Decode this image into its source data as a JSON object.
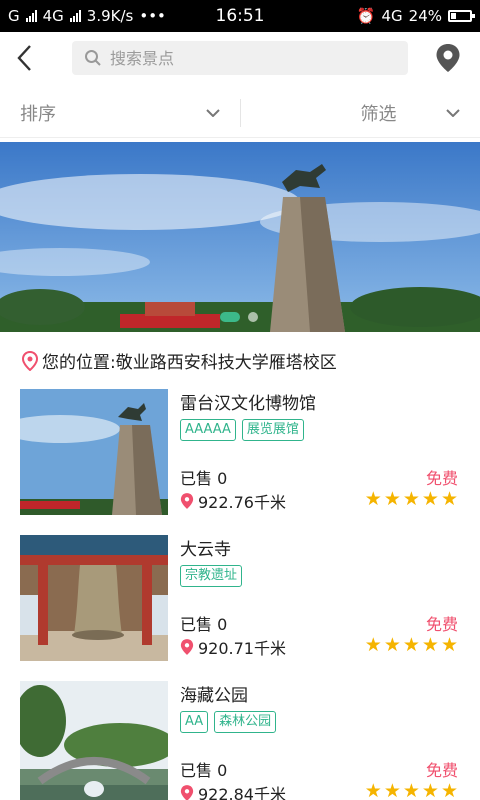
{
  "status": {
    "carrier": "G",
    "network": "4G",
    "speed": "3.9K/s",
    "dots": "•••",
    "time": "16:51",
    "net_right": "4G",
    "battery": "24%"
  },
  "search": {
    "placeholder": "搜索景点"
  },
  "filters": [
    {
      "label": "排序"
    },
    {
      "label": "筛选"
    }
  ],
  "banner": {
    "slides": 2,
    "active_index": 0
  },
  "location": {
    "text": "您的位置:敬业路西安科技大学雁塔校区"
  },
  "items": [
    {
      "title": "雷台汉文化博物馆",
      "tags": [
        "AAAAA",
        "展览展馆"
      ],
      "sold": "已售 0",
      "distance": "922.76千米",
      "price": "免费",
      "rating": 5
    },
    {
      "title": "大云寺",
      "tags": [
        "宗教遗址"
      ],
      "sold": "已售 0",
      "distance": "920.71千米",
      "price": "免费",
      "rating": 5
    },
    {
      "title": "海藏公园",
      "tags": [
        "AA",
        "森林公园"
      ],
      "sold": "已售 0",
      "distance": "922.84千米",
      "price": "免费",
      "rating": 5
    }
  ],
  "colors": {
    "accent": "#30b48c",
    "price": "#f0506e",
    "star": "#f5b400",
    "location_pin": "#f0506e"
  }
}
